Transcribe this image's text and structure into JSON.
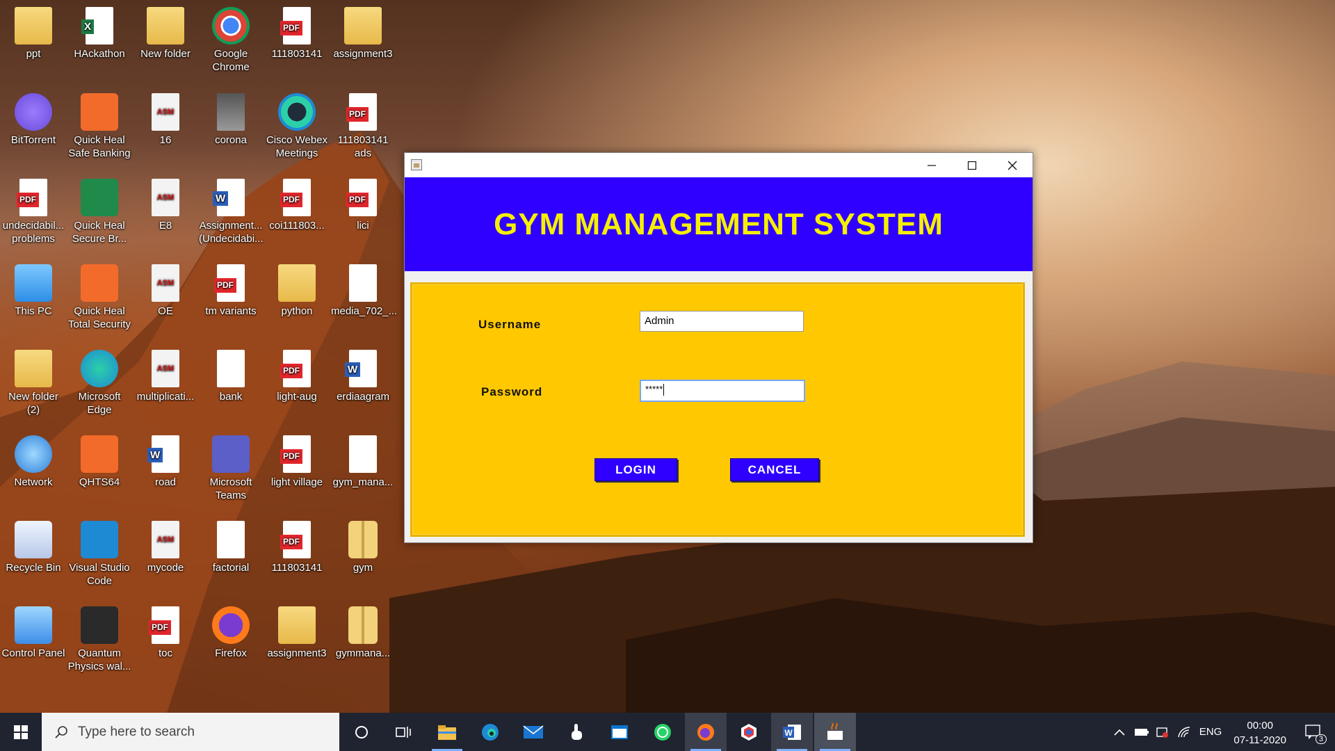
{
  "desktop_icons": [
    {
      "label": "ppt"
    },
    {
      "label": "HAckathon"
    },
    {
      "label": "New folder"
    },
    {
      "label": "Google Chrome"
    },
    {
      "label": "111803141"
    },
    {
      "label": "assignment3"
    },
    {
      "label": "BitTorrent"
    },
    {
      "label": "Quick Heal Safe Banking"
    },
    {
      "label": "16"
    },
    {
      "label": "corona"
    },
    {
      "label": "Cisco Webex Meetings"
    },
    {
      "label": "111803141 ads"
    },
    {
      "label": "undecidabil... problems"
    },
    {
      "label": "Quick Heal Secure Br..."
    },
    {
      "label": "E8"
    },
    {
      "label": "Assignment... (Undecidabi..."
    },
    {
      "label": "coi111803..."
    },
    {
      "label": "lici"
    },
    {
      "label": "This PC"
    },
    {
      "label": "Quick Heal Total Security"
    },
    {
      "label": "OE"
    },
    {
      "label": "tm variants"
    },
    {
      "label": "python"
    },
    {
      "label": "media_702_..."
    },
    {
      "label": "New folder (2)"
    },
    {
      "label": "Microsoft Edge"
    },
    {
      "label": "multiplicati..."
    },
    {
      "label": "bank"
    },
    {
      "label": "light-aug"
    },
    {
      "label": "erdiaagram"
    },
    {
      "label": "Network"
    },
    {
      "label": "QHTS64"
    },
    {
      "label": "road"
    },
    {
      "label": "Microsoft Teams"
    },
    {
      "label": "light village"
    },
    {
      "label": "gym_mana..."
    },
    {
      "label": "Recycle Bin"
    },
    {
      "label": "Visual Studio Code"
    },
    {
      "label": "mycode"
    },
    {
      "label": "factorial"
    },
    {
      "label": "111803141"
    },
    {
      "label": "gym"
    },
    {
      "label": "Control Panel"
    },
    {
      "label": "Quantum Physics wal..."
    },
    {
      "label": "toc"
    },
    {
      "label": "Firefox"
    },
    {
      "label": "assignment3"
    },
    {
      "label": "gymmana..."
    }
  ],
  "window": {
    "title": "GYM MANAGEMENT SYSTEM",
    "username_label": "Username",
    "username_value": "Admin",
    "password_label": "Password",
    "password_value": "*****",
    "login_label": "LOGIN",
    "cancel_label": "CANCEL",
    "colors": {
      "header": "#2f00ff",
      "title": "#f5f000",
      "panel": "#ffc800"
    }
  },
  "taskbar": {
    "search_placeholder": "Type here to search",
    "language": "ENG",
    "time": "00:00",
    "date": "07-11-2020",
    "notification_count": "3"
  }
}
